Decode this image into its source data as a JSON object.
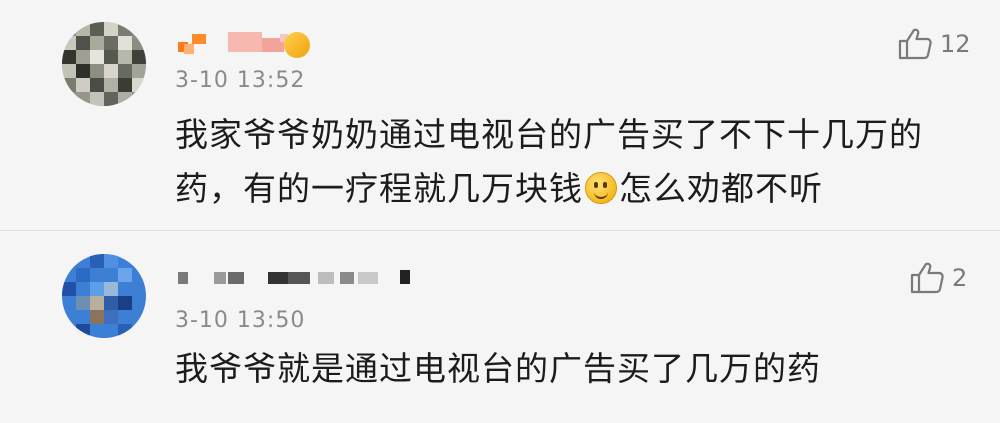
{
  "comments": [
    {
      "timestamp": "3-10 13:52",
      "text_part1": "我家爷爷奶奶通过电视台的广告买了不下十几万的药，有的一疗程就几万块钱",
      "emoji": "smile-emoji",
      "text_part2": "怎么劝都不听",
      "likes": "12"
    },
    {
      "timestamp": "3-10 13:50",
      "text": "我爷爷就是通过电视台的广告买了几万的药",
      "likes": "2"
    }
  ],
  "colors": {
    "background": "#f5f5f5",
    "timestamp": "#8a8a8a",
    "like": "#7a7a7a",
    "text": "#1c1c1c"
  }
}
